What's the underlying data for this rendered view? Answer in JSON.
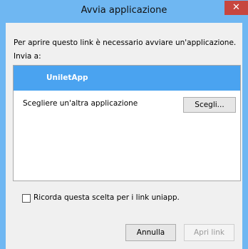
{
  "window": {
    "title": "Avvia applicazione",
    "close_glyph": "✕"
  },
  "dialog": {
    "message": "Per aprire questo link è necessario avviare un'applicazione.",
    "send_to_label": "Invia a:",
    "app_list": {
      "selected_app": "UniletApp",
      "other_app_label": "Scegliere un'altra applicazione",
      "choose_button": "Scegli..."
    },
    "remember": {
      "label": "Ricorda questa scelta per i link uniapp.",
      "checked": false
    },
    "buttons": {
      "cancel": "Annulla",
      "open_link": "Apri link"
    }
  },
  "colors": {
    "titlebar": "#6fb7f2",
    "selection": "#4aa3f0",
    "close": "#c7463f"
  }
}
